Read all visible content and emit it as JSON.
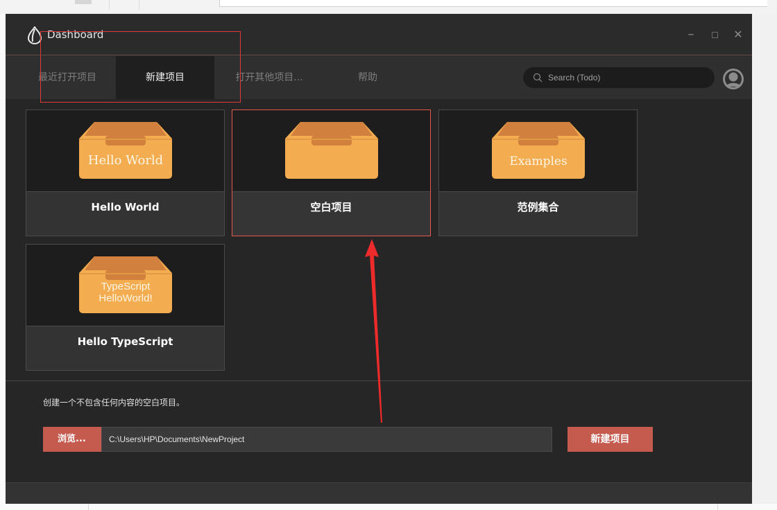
{
  "window": {
    "title": "Dashboard"
  },
  "tabs": [
    {
      "label": "最近打开项目",
      "active": false
    },
    {
      "label": "新建项目",
      "active": true
    },
    {
      "label": "打开其他项目...",
      "active": false
    },
    {
      "label": "帮助",
      "active": false
    }
  ],
  "search": {
    "placeholder": "Search (Todo)"
  },
  "templates": [
    {
      "name": "Hello World",
      "box_label": "Hello World",
      "selected": false
    },
    {
      "name": "空白项目",
      "box_label": "",
      "selected": true
    },
    {
      "name": "范例集合",
      "box_label": "Examples",
      "selected": false
    },
    {
      "name": "Hello TypeScript",
      "box_label": "TypeScript HelloWorld!",
      "box_label_line1": "TypeScript",
      "box_label_line2": "HelloWorld!",
      "selected": false
    }
  ],
  "footer": {
    "description": "创建一个不包含任何内容的空白项目。",
    "browse_label": "浏览...",
    "path_value": "C:\\Users\\HP\\Documents\\NewProject",
    "create_label": "新建项目"
  },
  "colors": {
    "accent": "#c55b4f",
    "box": "#f3ac4f",
    "box_inner": "#d1803d",
    "window_bg": "#262626"
  }
}
